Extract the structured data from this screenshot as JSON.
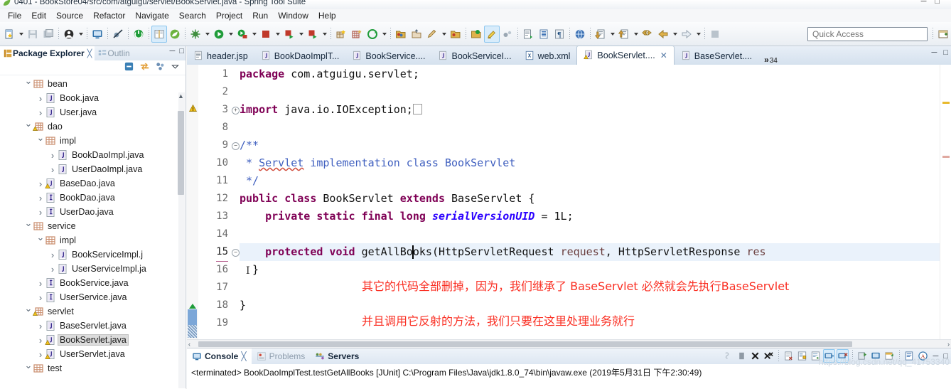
{
  "window": {
    "title": "0401 - BookStore04/src/com/atguigu/servlet/BookServlet.java - Spring Tool Suite",
    "app_icon": "sts-leaf-icon",
    "minimize": "minimize-button",
    "maximize": "maximize-button",
    "close": "close-button"
  },
  "menubar": {
    "items": [
      "File",
      "Edit",
      "Source",
      "Refactor",
      "Navigate",
      "Search",
      "Project",
      "Run",
      "Window",
      "Help"
    ]
  },
  "toolbar": {
    "quick_access_placeholder": "Quick Access",
    "groups": [
      {
        "items": [
          {
            "name": "new-wizard-icon",
            "caret": true
          },
          {
            "name": "save-icon",
            "caret": false
          },
          {
            "name": "save-all-icon",
            "caret": false
          }
        ]
      },
      {
        "items": [
          {
            "name": "user-account-icon",
            "caret": true
          }
        ]
      },
      {
        "items": [
          {
            "name": "open-console-icon",
            "caret": false
          }
        ]
      },
      {
        "items": [
          {
            "name": "skip-breakpoints-icon",
            "caret": false
          }
        ]
      },
      {
        "items": [
          {
            "name": "boot-dashboard-icon",
            "caret": false
          }
        ]
      },
      {
        "items": [
          {
            "name": "open-type-icon",
            "caret": false,
            "selected": true
          },
          {
            "name": "spring-leaf-icon",
            "caret": false
          }
        ]
      },
      {
        "items": [
          {
            "name": "debug-icon",
            "caret": true
          },
          {
            "name": "run-icon",
            "caret": true
          },
          {
            "name": "run-server-icon",
            "caret": true
          },
          {
            "name": "terminate-icon",
            "caret": true
          },
          {
            "name": "run-last-icon",
            "caret": true
          },
          {
            "name": "run-external-icon",
            "caret": true
          }
        ]
      },
      {
        "items": [
          {
            "name": "new-java-package-icon",
            "caret": false
          },
          {
            "name": "new-java-class-icon",
            "caret": false
          },
          {
            "name": "new-generic-icon",
            "caret": true
          }
        ]
      },
      {
        "items": [
          {
            "name": "open-folder-icon",
            "caret": false
          },
          {
            "name": "export-icon",
            "caret": false
          },
          {
            "name": "pencil-edit-icon",
            "caret": true
          },
          {
            "name": "folder-view-icon",
            "caret": false
          }
        ]
      },
      {
        "items": [
          {
            "name": "search-project-icon",
            "caret": false
          },
          {
            "name": "highlight-marker-icon",
            "caret": false,
            "selected": true
          },
          {
            "name": "toggle-mark-occurrences-icon",
            "caret": false
          }
        ]
      },
      {
        "items": [
          {
            "name": "next-annotation-icon",
            "caret": false
          },
          {
            "name": "show-whitespace-icon",
            "caret": false
          },
          {
            "name": "paragraph-mark-icon",
            "caret": false
          }
        ]
      },
      {
        "items": [
          {
            "name": "open-web-browser-icon",
            "caret": false
          }
        ]
      },
      {
        "items": [
          {
            "name": "next-edit-icon",
            "caret": true
          },
          {
            "name": "previous-edit-icon",
            "caret": true
          },
          {
            "name": "back-history-icon",
            "caret": false
          },
          {
            "name": "back-arrow-icon",
            "caret": true
          },
          {
            "name": "forward-arrow-icon",
            "caret": true
          }
        ]
      },
      {
        "items": [
          {
            "name": "perspective-open-icon",
            "caret": false
          }
        ]
      }
    ]
  },
  "package_explorer": {
    "tab_label": "Package Explorer",
    "tab_close": "╳",
    "secondary_tab_label": "Outlin",
    "view_buttons": [
      "collapse-all-icon",
      "link-with-editor-icon",
      "view-filter-icon",
      "view-menu-icon"
    ],
    "minimize_icon": "minimize-view-icon",
    "maximize_icon": "maximize-view-icon",
    "scroll_up": "▲",
    "scroll_down": "▼",
    "tree": [
      {
        "label": "bean",
        "indent": 2,
        "arrow": "open",
        "icon": "package-icon",
        "selected": false
      },
      {
        "label": "Book.java",
        "indent": 3,
        "arrow": "closed",
        "icon": "java-file-icon",
        "selected": false
      },
      {
        "label": "User.java",
        "indent": 3,
        "arrow": "closed",
        "icon": "java-file-icon",
        "selected": false
      },
      {
        "label": "dao",
        "indent": 2,
        "arrow": "open",
        "icon": "package-warning-icon",
        "selected": false
      },
      {
        "label": "impl",
        "indent": 3,
        "arrow": "open",
        "icon": "package-icon",
        "selected": false
      },
      {
        "label": "BookDaoImpl.java",
        "indent": 4,
        "arrow": "closed",
        "icon": "java-file-icon",
        "selected": false
      },
      {
        "label": "UserDaoImpl.java",
        "indent": 4,
        "arrow": "closed",
        "icon": "java-file-icon",
        "selected": false
      },
      {
        "label": "BaseDao.java",
        "indent": 3,
        "arrow": "closed",
        "icon": "java-file-warning-icon",
        "selected": false
      },
      {
        "label": "BookDao.java",
        "indent": 3,
        "arrow": "closed",
        "icon": "java-interface-icon",
        "selected": false
      },
      {
        "label": "UserDao.java",
        "indent": 3,
        "arrow": "closed",
        "icon": "java-interface-icon",
        "selected": false
      },
      {
        "label": "service",
        "indent": 2,
        "arrow": "open",
        "icon": "package-icon",
        "selected": false
      },
      {
        "label": "impl",
        "indent": 3,
        "arrow": "open",
        "icon": "package-icon",
        "selected": false
      },
      {
        "label": "BookServiceImpl.j",
        "indent": 4,
        "arrow": "closed",
        "icon": "java-file-icon",
        "selected": false
      },
      {
        "label": "UserServiceImpl.ja",
        "indent": 4,
        "arrow": "closed",
        "icon": "java-file-icon",
        "selected": false
      },
      {
        "label": "BookService.java",
        "indent": 3,
        "arrow": "closed",
        "icon": "java-interface-icon",
        "selected": false
      },
      {
        "label": "UserService.java",
        "indent": 3,
        "arrow": "closed",
        "icon": "java-interface-icon",
        "selected": false
      },
      {
        "label": "servlet",
        "indent": 2,
        "arrow": "open",
        "icon": "package-warning-icon",
        "selected": false
      },
      {
        "label": "BaseServlet.java",
        "indent": 3,
        "arrow": "closed",
        "icon": "java-file-icon",
        "selected": false
      },
      {
        "label": "BookServlet.java",
        "indent": 3,
        "arrow": "closed",
        "icon": "java-file-warning-icon",
        "selected": true
      },
      {
        "label": "UserServlet.java",
        "indent": 3,
        "arrow": "closed",
        "icon": "java-file-warning-icon",
        "selected": false
      },
      {
        "label": "test",
        "indent": 2,
        "arrow": "open",
        "icon": "package-icon",
        "selected": false
      }
    ]
  },
  "editor": {
    "tabs": [
      {
        "label": "header.jsp",
        "icon": "jsp-file-icon",
        "active": false,
        "closable": false
      },
      {
        "label": "BookDaoImplT...",
        "icon": "java-file-icon",
        "active": false,
        "closable": false
      },
      {
        "label": "BookService....",
        "icon": "java-file-icon",
        "active": false,
        "closable": false
      },
      {
        "label": "BookServiceI...",
        "icon": "java-file-icon",
        "active": false,
        "closable": false
      },
      {
        "label": "web.xml",
        "icon": "xml-file-icon",
        "active": false,
        "closable": false
      },
      {
        "label": "BookServlet....",
        "icon": "java-file-warning-icon",
        "active": true,
        "closable": true
      },
      {
        "label": "BaseServlet....",
        "icon": "java-file-icon",
        "active": false,
        "closable": false
      }
    ],
    "overflow_symbol": "»",
    "overflow_count": "34",
    "minimize_icon": "minimize-editor-icon",
    "maximize_icon": "maximize-editor-icon",
    "line_numbers": [
      "1",
      "2",
      "3",
      "8",
      "9",
      "10",
      "11",
      "12",
      "13",
      "14",
      "15",
      "16",
      "17",
      "18",
      "19"
    ],
    "current_line": "15",
    "lines": [
      {
        "n": "1",
        "tokens": [
          {
            "t": "package",
            "c": "kw2"
          },
          {
            "t": " com.atguigu.servlet;",
            "c": "plain"
          }
        ]
      },
      {
        "n": "2",
        "tokens": []
      },
      {
        "n": "3",
        "fold": "plus",
        "annotation": "warning-icon",
        "tokens": [
          {
            "t": "import",
            "c": "kw2"
          },
          {
            "t": " java.io.IOException;",
            "c": "plain"
          },
          {
            "t": "",
            "c": "placeholder"
          }
        ]
      },
      {
        "n": "8",
        "tokens": []
      },
      {
        "n": "9",
        "fold": "minus",
        "tokens": [
          {
            "t": "/**",
            "c": "cmt"
          }
        ]
      },
      {
        "n": "10",
        "tokens": [
          {
            "t": " * ",
            "c": "cmt"
          },
          {
            "t": "Servlet",
            "c": "cmt-squiggle"
          },
          {
            "t": " implementation class BookServlet",
            "c": "cmt"
          }
        ]
      },
      {
        "n": "11",
        "tokens": [
          {
            "t": " */",
            "c": "cmt"
          }
        ]
      },
      {
        "n": "12",
        "tokens": [
          {
            "t": "public class",
            "c": "kw2"
          },
          {
            "t": " BookServlet ",
            "c": "plain"
          },
          {
            "t": "extends",
            "c": "kw2"
          },
          {
            "t": " BaseServlet {",
            "c": "plain"
          }
        ]
      },
      {
        "n": "13",
        "tokens": [
          {
            "t": "    ",
            "c": "plain"
          },
          {
            "t": "private static final long",
            "c": "kw2"
          },
          {
            "t": " ",
            "c": "plain"
          },
          {
            "t": "serialVersionUID",
            "c": "fld"
          },
          {
            "t": " = 1L;",
            "c": "plain"
          }
        ]
      },
      {
        "n": "14",
        "tokens": []
      },
      {
        "n": "15",
        "fold": "minus",
        "current": true,
        "tokens": [
          {
            "t": "    ",
            "c": "plain"
          },
          {
            "t": "protected void",
            "c": "kw2"
          },
          {
            "t": " getAllBooks",
            "c": "plain"
          },
          {
            "t": "(HttpServletRequest ",
            "c": "plain"
          },
          {
            "t": "request",
            "c": "par"
          },
          {
            "t": ", HttpServletResponse ",
            "c": "plain"
          },
          {
            "t": "res",
            "c": "par"
          }
        ]
      },
      {
        "n": "16",
        "tokens": [
          {
            "t": "  }",
            "c": "plain"
          }
        ]
      },
      {
        "n": "17",
        "tokens": []
      },
      {
        "n": "18",
        "tokens": [
          {
            "t": "}",
            "c": "plain"
          }
        ]
      },
      {
        "n": "19",
        "tokens": []
      }
    ],
    "annotations": [
      {
        "text": "其它的代码全部删掉，因为，我们继承了 BaseServlet 必然就会先执行BaseServlet",
        "color": "#fa2f23"
      },
      {
        "text": "并且调用它反射的方法，我们只要在这里处理业务就行",
        "color": "#fa2f23"
      }
    ],
    "scroll_left_arrow": "‹",
    "scroll_right_arrow": "›"
  },
  "console": {
    "tabs": [
      {
        "label": "Console",
        "icon": "console-icon",
        "active": true,
        "closable": true
      },
      {
        "label": "Problems",
        "icon": "problems-icon",
        "active": false,
        "closable": false
      },
      {
        "label": "Servers",
        "icon": "servers-icon",
        "active": false,
        "closable": false
      }
    ],
    "close_symbol": "╳",
    "tools": [
      {
        "name": "terminate-all-icon",
        "active": false
      },
      {
        "name": "remove-launch-icon",
        "active": false
      },
      {
        "name": "remove-all-terminated-icon",
        "active": false
      },
      {
        "name": "remove-all-icon",
        "active": false
      },
      {
        "name": "clear-console-icon",
        "active": false
      },
      {
        "name": "scroll-lock-icon",
        "active": false
      },
      {
        "name": "word-wrap-icon",
        "active": false
      },
      {
        "name": "show-console-on-output-icon",
        "active": true
      },
      {
        "name": "show-console-on-error-icon",
        "active": true
      },
      {
        "name": "pin-console-icon",
        "active": false
      },
      {
        "name": "display-selected-console-icon",
        "active": false
      },
      {
        "name": "open-console-icon",
        "active": false
      },
      {
        "name": "copy-console-icon",
        "active": false
      },
      {
        "name": "find-replace-icon",
        "active": false
      }
    ],
    "minimize_icon": "minimize-console-icon",
    "maximize_icon": "maximize-console-icon",
    "output": "<terminated> BookDaoImplTest.testGetAllBooks [JUnit] C:\\Program Files\\Java\\jdk1.8.0_74\\bin\\javaw.exe (2019年5月31日 下午2:30:49)"
  },
  "watermark": {
    "text": "https://blog.csdn.net/qq_41753340"
  },
  "colors": {
    "keyword": "#7f0055",
    "comment": "#3f5fbf",
    "field": "#2a00ff",
    "parameter": "#6a3e3e",
    "annotation_red": "#fa2f23",
    "current_line": "#eaf2fb",
    "selection": "#dcdcdc",
    "toolbar_selected": "#d8ecfb"
  }
}
